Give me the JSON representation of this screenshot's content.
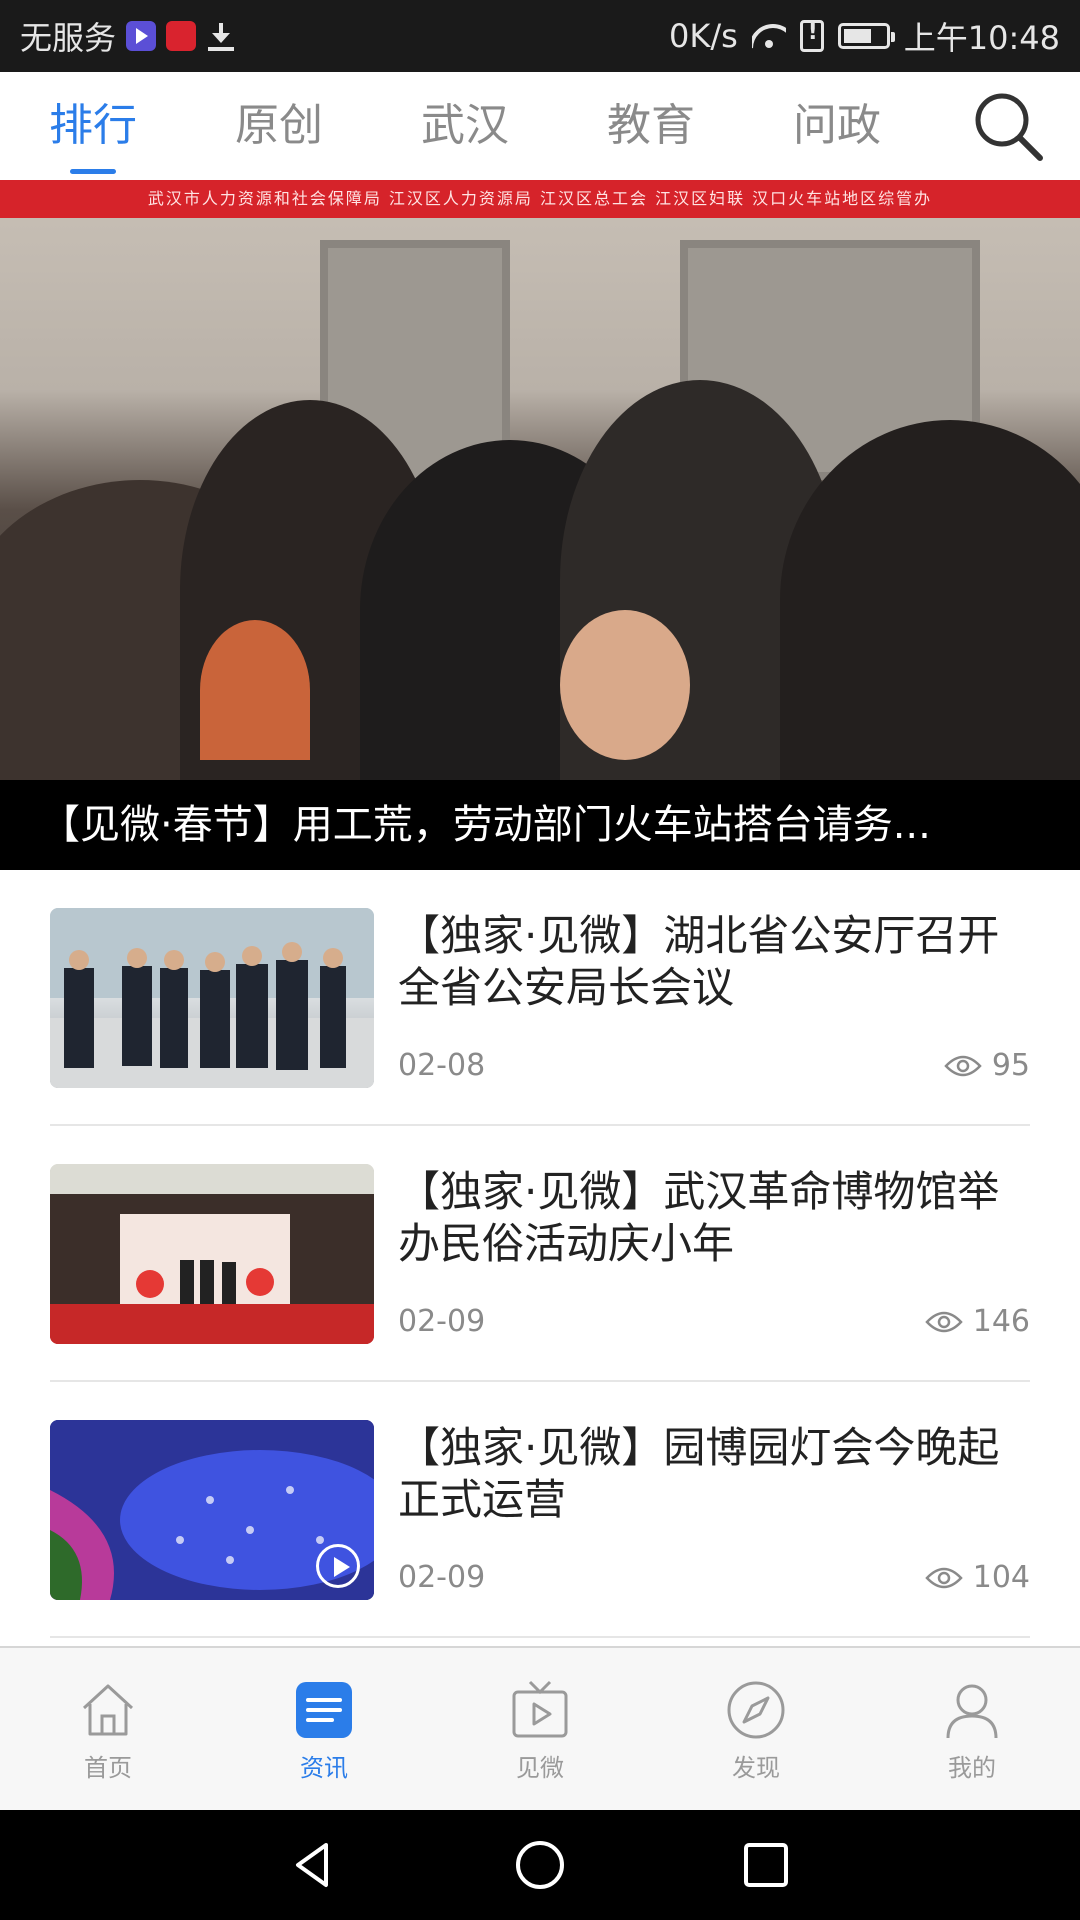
{
  "status_bar": {
    "carrier": "无服务",
    "speed": "0K/s",
    "time": "上午10:48"
  },
  "tabs": [
    {
      "label": "排行",
      "active": true
    },
    {
      "label": "原创",
      "active": false
    },
    {
      "label": "武汉",
      "active": false
    },
    {
      "label": "教育",
      "active": false
    },
    {
      "label": "问政",
      "active": false
    }
  ],
  "search": {
    "icon": "search-icon"
  },
  "hero": {
    "banner_text": "武汉市人力资源和社会保障局 江汉区人力资源局 江汉区总工会 江汉区妇联 汉口火车站地区综管办",
    "caption": "【见微·春节】用工荒，劳动部门火车站搭台请务..."
  },
  "news": [
    {
      "title": "【独家·见微】湖北省公安厅召开全省公安局长会议",
      "date": "02-08",
      "views": "95",
      "video": false
    },
    {
      "title": "【独家·见微】武汉革命博物馆举办民俗活动庆小年",
      "date": "02-09",
      "views": "146",
      "video": false
    },
    {
      "title": "【独家·见微】园博园灯会今晚起正式运营",
      "date": "02-09",
      "views": "104",
      "video": true
    }
  ],
  "bottom_nav": [
    {
      "label": "首页",
      "icon": "home-icon",
      "active": false
    },
    {
      "label": "资讯",
      "icon": "news-icon",
      "active": true
    },
    {
      "label": "见微",
      "icon": "video-tv-icon",
      "active": false
    },
    {
      "label": "发现",
      "icon": "compass-icon",
      "active": false
    },
    {
      "label": "我的",
      "icon": "profile-icon",
      "active": false
    }
  ],
  "colors": {
    "accent": "#2b7de9",
    "inactive": "#8a8a8a",
    "status_bar_bg": "#1a1a1a"
  }
}
